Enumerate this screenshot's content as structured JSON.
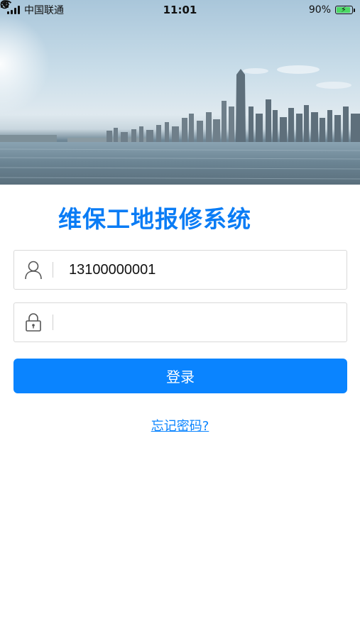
{
  "status_bar": {
    "carrier": "中国联通",
    "time": "11:01",
    "battery_percent": "90%",
    "icons": [
      "signal-icon",
      "wifi-icon",
      "rotation-lock-icon",
      "location-icon",
      "headphones-icon",
      "battery-charging-icon"
    ]
  },
  "hero": {
    "icon": "city-skyline-image"
  },
  "title": "维保工地报修系统",
  "login_form": {
    "username": {
      "value": "13100000001",
      "icon": "user-icon"
    },
    "password": {
      "value": "",
      "icon": "lock-icon"
    },
    "submit_label": "登录",
    "forgot_label": "忘记密码?"
  },
  "colors": {
    "accent": "#0a84ff",
    "title": "#0a7cf5",
    "border": "#d9d9d9"
  }
}
